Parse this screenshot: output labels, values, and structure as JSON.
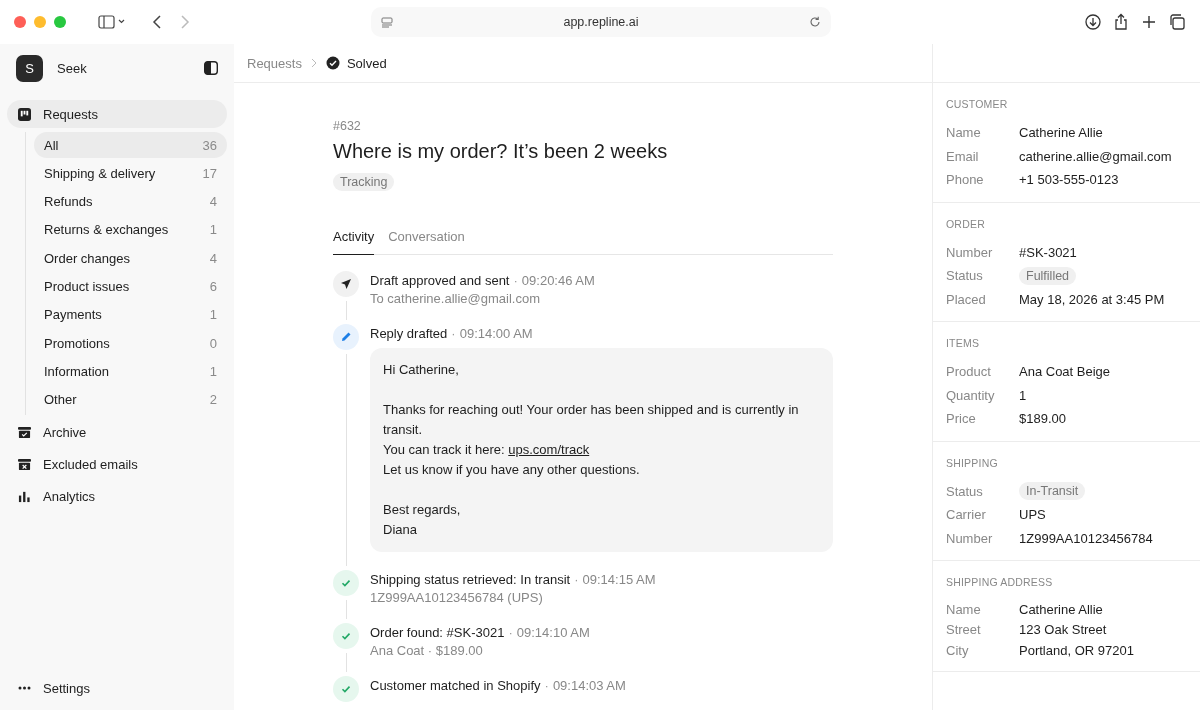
{
  "browser": {
    "url": "app.repline.ai",
    "forward_disabled": true
  },
  "sidebar": {
    "workspace": {
      "initial": "S",
      "name": "Seek"
    },
    "items": [
      {
        "label": "Requests",
        "kind": "requests",
        "selected": true,
        "expanded": true,
        "children": [
          {
            "label": "All",
            "count": "36",
            "selected": true
          },
          {
            "label": "Shipping & delivery",
            "count": "17",
            "selected": false
          },
          {
            "label": "Refunds",
            "count": "4",
            "selected": false
          },
          {
            "label": "Returns & exchanges",
            "count": "1",
            "selected": false
          },
          {
            "label": "Order changes",
            "count": "4",
            "selected": false
          },
          {
            "label": "Product issues",
            "count": "6",
            "selected": false
          },
          {
            "label": "Payments",
            "count": "1",
            "selected": false
          },
          {
            "label": "Promotions",
            "count": "0",
            "selected": false
          },
          {
            "label": "Information",
            "count": "1",
            "selected": false
          },
          {
            "label": "Other",
            "count": "2",
            "selected": false
          }
        ]
      },
      {
        "label": "Archive",
        "kind": "archive",
        "selected": false
      },
      {
        "label": "Excluded emails",
        "kind": "excluded",
        "selected": false
      },
      {
        "label": "Analytics",
        "kind": "analytics",
        "selected": false
      }
    ],
    "settings": "Settings"
  },
  "breadcrumb": {
    "parent": "Requests",
    "current": "Solved"
  },
  "request": {
    "number": "#632",
    "title": "Where is my order? It’s been 2 weeks",
    "tag": "Tracking"
  },
  "tabs": [
    {
      "label": "Activity",
      "selected": true
    },
    {
      "label": "Conversation",
      "selected": false
    }
  ],
  "events": [
    {
      "kind": "sent",
      "title": "Draft approved and sent",
      "separator": "·",
      "time": "09:20:46 AM",
      "detail": "To catherine.allie@gmail.com"
    },
    {
      "kind": "drafted",
      "title": "Reply drafted",
      "separator": "·",
      "time": "09:14:00 AM",
      "message": [
        [
          {
            "text": "Hi Catherine,"
          }
        ],
        [
          {
            "text": "Thanks for reaching out! Your order has been shipped and is currently in transit."
          },
          {
            "text": "You can track it here:",
            "link": "ups.com/track"
          },
          {
            "text": "Let us know if you have any other questions."
          }
        ],
        [
          {
            "text": "Best regards,"
          },
          {
            "text": "Diana"
          }
        ]
      ]
    },
    {
      "kind": "done",
      "title": "Shipping status retrieved: In transit",
      "separator": "·",
      "time": "09:14:15 AM",
      "detail": "1Z999AA10123456784 (UPS)"
    },
    {
      "kind": "done",
      "title": "Order found: #SK-3021",
      "separator": "·",
      "time": "09:14:10 AM",
      "detail": "Ana Coat · $189.00"
    },
    {
      "kind": "done",
      "title": "Customer matched in Shopify",
      "separator": "·",
      "time": "09:14:03 AM"
    }
  ],
  "details": [
    {
      "title": "CUSTOMER",
      "fields": [
        {
          "label": "Name",
          "value": "Catherine Allie",
          "kind": "text"
        },
        {
          "label": "Email",
          "value": "catherine.allie@gmail.com",
          "kind": "text"
        },
        {
          "label": "Phone",
          "value": "+1 503-555-0123",
          "kind": "text"
        }
      ]
    },
    {
      "title": "ORDER",
      "fields": [
        {
          "label": "Number",
          "value": "#SK-3021",
          "kind": "text"
        },
        {
          "label": "Status",
          "value": "Fulfilled",
          "kind": "pill"
        },
        {
          "label": "Placed",
          "value": "May 18, 2026 at 3:45 PM",
          "kind": "text"
        }
      ]
    },
    {
      "title": "ITEMS",
      "fields": [
        {
          "label": "Product",
          "value": "Ana Coat Beige",
          "kind": "text"
        },
        {
          "label": "Quantity",
          "value": "1",
          "kind": "text"
        },
        {
          "label": "Price",
          "value": "$189.00",
          "kind": "text"
        }
      ]
    },
    {
      "title": "SHIPPING",
      "fields": [
        {
          "label": "Status",
          "value": "In-Transit",
          "kind": "pill"
        },
        {
          "label": "Carrier",
          "value": "UPS",
          "kind": "text"
        },
        {
          "label": "Number",
          "value": "1Z999AA10123456784",
          "kind": "text"
        }
      ]
    },
    {
      "title": "SHIPPING ADDRESS",
      "fields": [
        {
          "label": "Name",
          "value": "Catherine Allie",
          "kind": "text"
        },
        {
          "label": "Street",
          "value": "123 Oak Street",
          "kind": "text"
        },
        {
          "label": "City",
          "value": "Portland, OR 97201",
          "kind": "text"
        }
      ]
    }
  ]
}
